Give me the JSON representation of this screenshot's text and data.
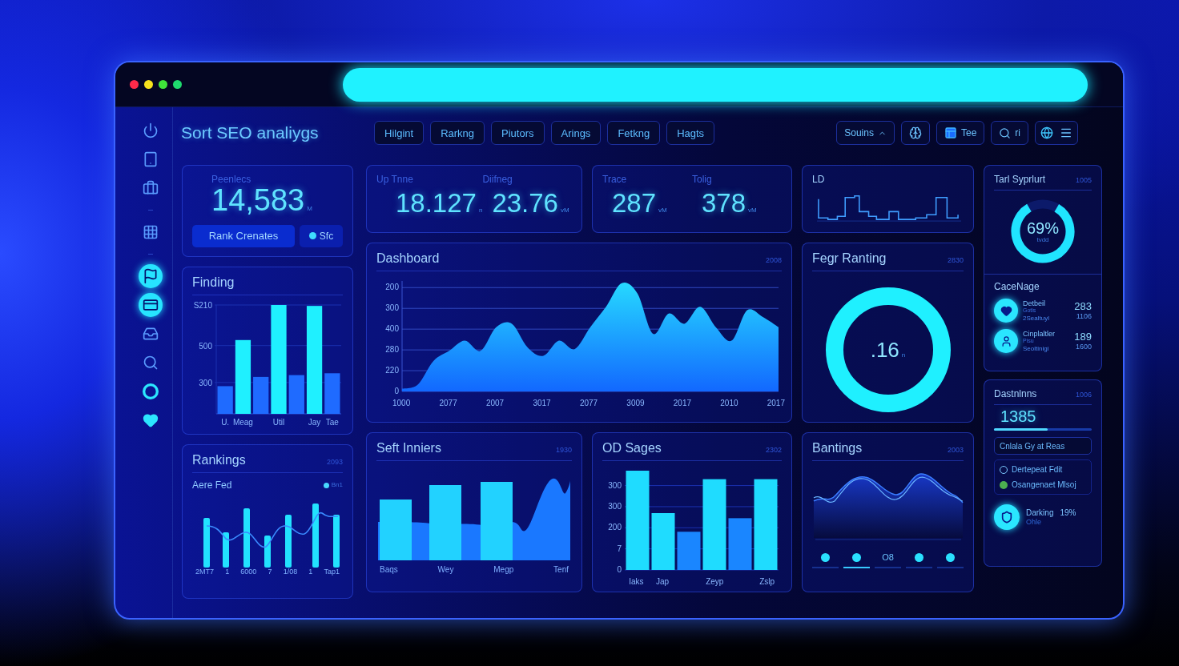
{
  "window_controls": [
    {
      "color": "#ff2a4a"
    },
    {
      "color": "#f5e11d"
    },
    {
      "color": "#3fe33a"
    },
    {
      "color": "#1fd96e"
    }
  ],
  "sidebar": {
    "items": [
      {
        "active": false
      },
      {
        "active": false
      },
      {
        "active": false
      },
      {
        "active": false
      },
      {
        "active": true
      },
      {
        "active": true
      },
      {
        "active": false
      },
      {
        "active": false
      },
      {
        "active": false
      },
      {
        "active": false
      }
    ]
  },
  "app_title": "Sort SEO analiygs",
  "tabs": [
    {
      "label": "Hilgint",
      "selected": false
    },
    {
      "label": "Rarkng",
      "selected": false
    },
    {
      "label": "Piutors",
      "selected": false
    },
    {
      "label": "Arings",
      "selected": false
    },
    {
      "label": "Fetkng",
      "selected": false
    },
    {
      "label": "Hagts",
      "selected": false
    }
  ],
  "toolbar": {
    "dropdown": "Souins",
    "calendar_button": "Tee",
    "search_button": "ri"
  },
  "summary_card": {
    "label": "Peenlecs",
    "value": "14,583",
    "unit": "M",
    "primary_button": "Rank Crenates",
    "status_button": "Sfc"
  },
  "metric_cards": [
    {
      "metrics": [
        {
          "label": "Up Tnne",
          "value": "18.127",
          "unit": "n"
        },
        {
          "label": "Diifneg",
          "value": "23.76",
          "unit": "vM"
        }
      ]
    },
    {
      "metrics": [
        {
          "label": "Trace",
          "value": "287",
          "unit": "vM"
        },
        {
          "label": "Tolig",
          "value": "378",
          "unit": "vM"
        }
      ]
    }
  ],
  "sparkline_card": {
    "title": "LD"
  },
  "gauge_card": {
    "title": "Tarl Syprlurt",
    "note": "1005",
    "value": "69%",
    "caption": "tvdd",
    "level": 0.83
  },
  "coverage": {
    "title": "CaceNage",
    "rows": [
      {
        "name": "Detbeil",
        "detail": "Gotis",
        "sub": "2Sealtuyl",
        "value": "283",
        "sub_value": "1106"
      },
      {
        "name": "Cinplaltler",
        "detail": "Pisu",
        "sub": "Seoltinigi",
        "value": "189",
        "sub_value": "1600"
      }
    ]
  },
  "finding_chart": {
    "title": "Finding",
    "chart_data": {
      "type": "bar",
      "categories": [
        "U.",
        "Meag",
        null,
        "Util",
        null,
        "Jay",
        "Tae"
      ],
      "ylim": [
        130,
        720
      ],
      "yticks": [
        {
          "value": 300,
          "label": "300"
        },
        {
          "value": 500,
          "label": "500"
        },
        {
          "value": 720,
          "label": "S210"
        }
      ],
      "grid": true,
      "series": [
        {
          "color": "#1ff0ff",
          "values": [
            null,
            530,
            null,
            720,
            null,
            715,
            null
          ]
        },
        {
          "color": "#1f6bff",
          "values": [
            280,
            null,
            330,
            null,
            340,
            null,
            350
          ]
        }
      ]
    }
  },
  "dashboard_chart": {
    "title": "Dashboard",
    "note": "2008",
    "y_labels": [
      "200",
      "300",
      "400",
      "280",
      "220",
      "0"
    ],
    "x_labels": [
      "1000",
      "2077",
      "2007",
      "3017",
      "2077",
      "3009",
      "2017",
      "2010",
      "2017"
    ]
  },
  "ring_card": {
    "title": "Fegr Ranting",
    "note": "2830",
    "value": ".16",
    "unit": "n"
  },
  "rankings_chart": {
    "title": "Rankings",
    "note": "2093",
    "subtitle": "Aere Fed",
    "legend": "Bn1",
    "x_labels": [
      "2MT7",
      "1",
      "6000",
      "7",
      "1/08",
      "1",
      "Tap1"
    ]
  },
  "seft_chart": {
    "title": "Seft Inniers",
    "note": "1930",
    "x_labels": [
      "Baqs",
      "Wey",
      "Megp",
      "Tenf"
    ]
  },
  "od_chart": {
    "title": "OD Sages",
    "note": "2302",
    "y_labels": [
      "300",
      "300",
      "200",
      "7",
      "0"
    ],
    "x_labels": [
      "Iaks",
      "Jap",
      "Zeyp",
      "Zslp"
    ]
  },
  "bantings": {
    "title": "Bantings",
    "note": "2003",
    "steps": [
      {
        "kind": "dot",
        "selected": false
      },
      {
        "kind": "dot",
        "selected": true
      },
      {
        "kind": "text",
        "label": "O8",
        "selected": false
      },
      {
        "kind": "dot",
        "selected": false
      },
      {
        "kind": "dot",
        "selected": false
      }
    ]
  },
  "destinations": {
    "title": "Dastnlnns",
    "note": "1006",
    "value": "1385",
    "level": 0.55,
    "filter": "Cnlala Gy at Reas",
    "options": [
      {
        "label": "Dertepeat Fdit",
        "selected": false
      },
      {
        "label": "Osangenaet Mlsoj",
        "selected": true
      }
    ],
    "highlight": {
      "label": "Darking",
      "value": "19%",
      "caption": "Ohle"
    }
  }
}
